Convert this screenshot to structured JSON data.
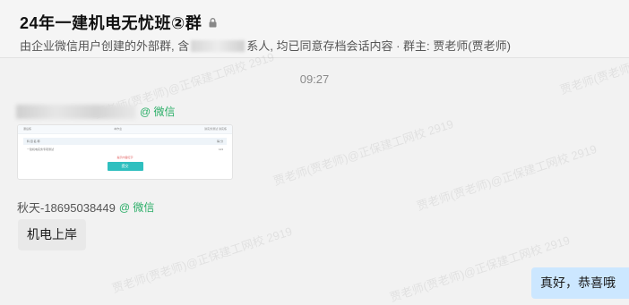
{
  "header": {
    "title": "24年一建机电无忧班②群",
    "subtitle_pre": "由企业微信用户创建的外部群, 含",
    "subtitle_post": "系人, 均已同意存档会话内容",
    "owner": "· 群主: 贾老师(贾老师)",
    "lock_icon": "lock-icon"
  },
  "watermark_text": "贾老师(贾老师)@正保建工网校 2919",
  "chat": {
    "time": "09:27",
    "messages": [
      {
        "sender_suffix": "@ 微信",
        "type": "image-card",
        "card": {
          "head_left": "课后练",
          "head_mid": "本作业",
          "head_right": "讲实务测试 讲实练",
          "col1": "科 目 名 称",
          "col2": "得 分",
          "row1_left": "一建机电实务专项测试",
          "row1_right": "123",
          "note": "提示内容红字",
          "button": "提交"
        }
      },
      {
        "sender_name": "秋天-18695038449",
        "sender_suffix": "@ 微信",
        "type": "text",
        "text": "机电上岸"
      },
      {
        "type": "text-outgoing",
        "text": "真好，恭喜哦"
      }
    ]
  },
  "colors": {
    "wechat_green": "#2aae67",
    "incoming_bubble": "#e9e9e9",
    "outgoing_bubble": "#cce7ff",
    "background": "#f2f2f2"
  }
}
